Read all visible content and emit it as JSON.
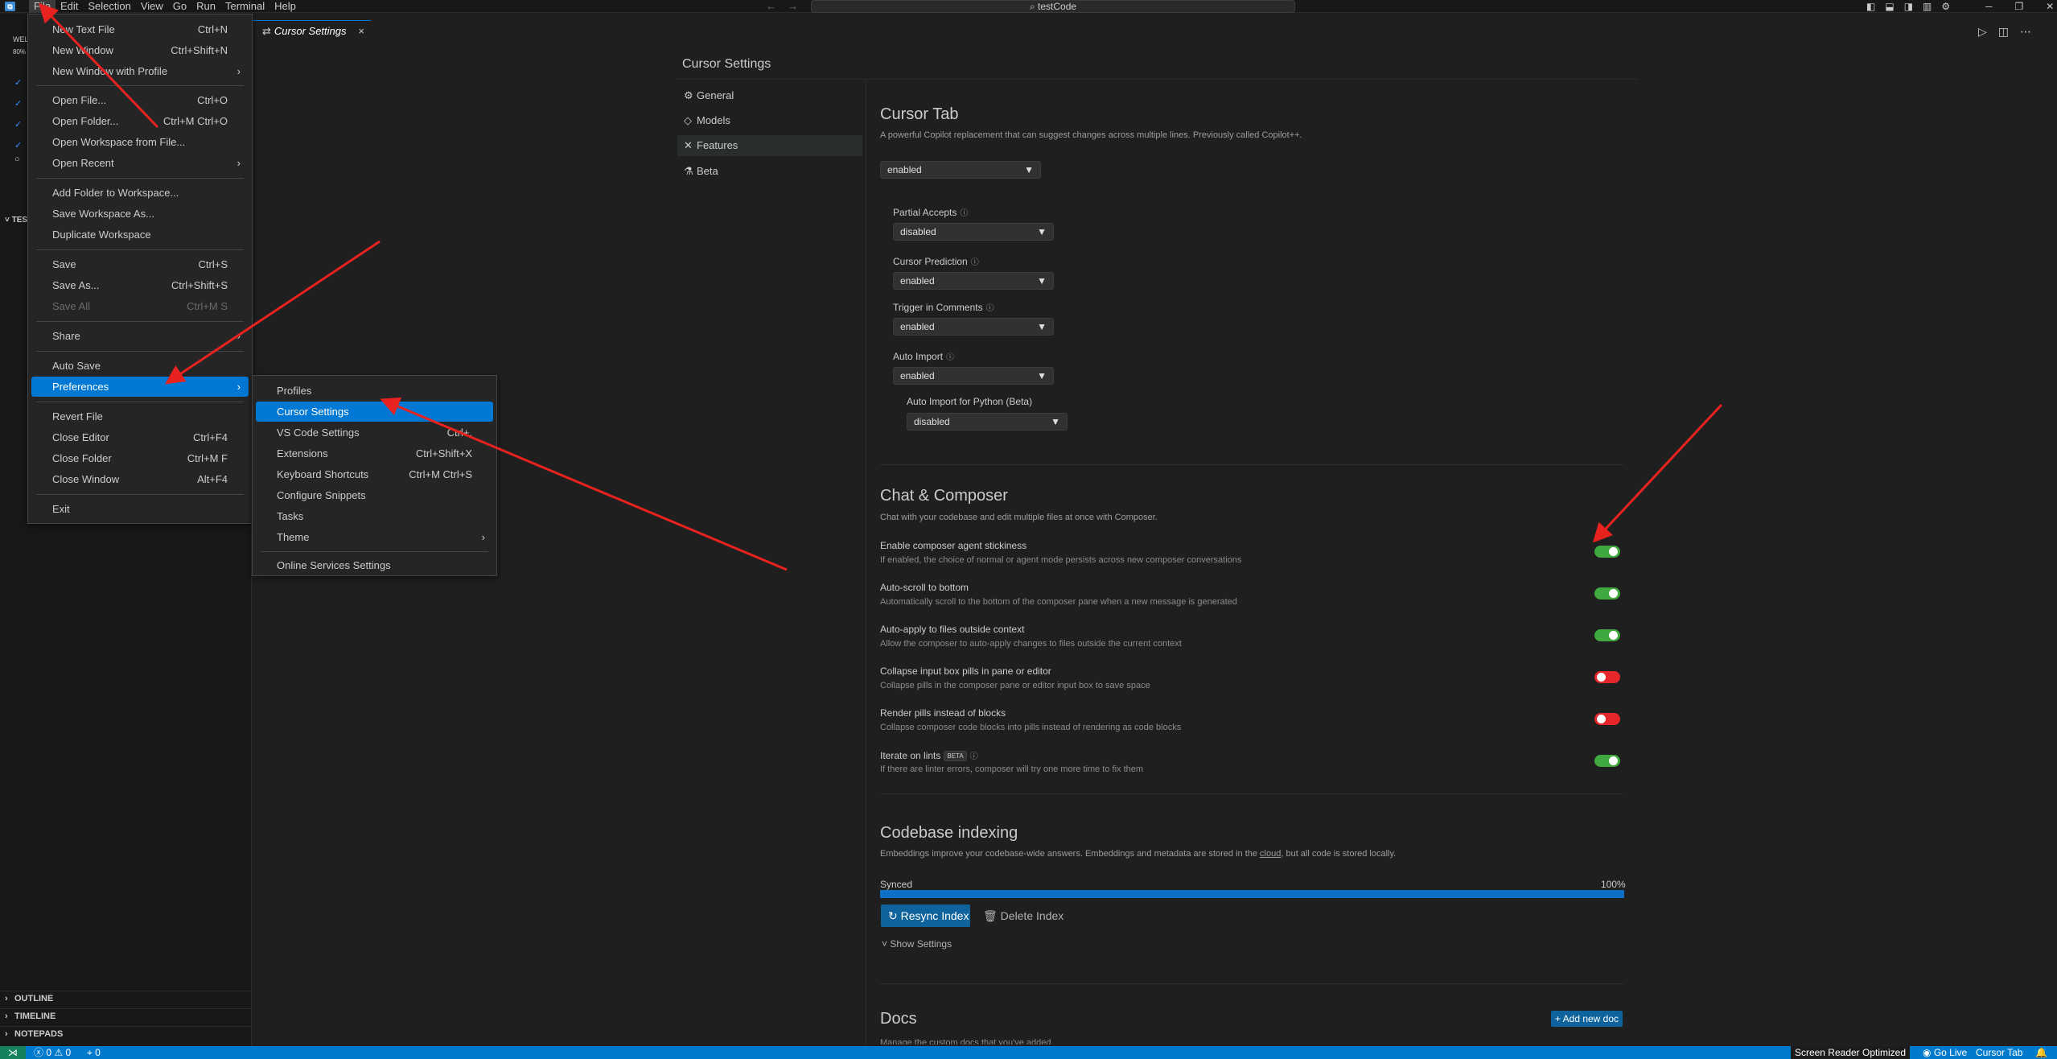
{
  "window": {
    "app_icon": "vscode-logo-icon",
    "search_text": "testCode",
    "menubar": [
      "File",
      "Edit",
      "Selection",
      "View",
      "Go",
      "Run",
      "Terminal",
      "Help"
    ]
  },
  "sidebar": {
    "peek_top": "WEL",
    "peek_pct": "80%",
    "peek_section": "TES",
    "sections": [
      "OUTLINE",
      "TIMELINE",
      "NOTEPADS"
    ]
  },
  "tabs": [
    {
      "label": "Cursor Settings",
      "close": "×"
    }
  ],
  "file_menu": [
    {
      "label": "New Text File",
      "kb": "Ctrl+N"
    },
    {
      "label": "New Window",
      "kb": "Ctrl+Shift+N"
    },
    {
      "label": "New Window with Profile",
      "kb": "",
      "sub": true
    },
    {
      "label": "Open File...",
      "kb": "Ctrl+O"
    },
    {
      "label": "Open Folder...",
      "kb": "Ctrl+M Ctrl+O"
    },
    {
      "label": "Open Workspace from File...",
      "kb": ""
    },
    {
      "label": "Open Recent",
      "kb": "",
      "sub": true
    },
    {
      "label": "Add Folder to Workspace...",
      "kb": ""
    },
    {
      "label": "Save Workspace As...",
      "kb": ""
    },
    {
      "label": "Duplicate Workspace",
      "kb": ""
    },
    {
      "label": "Save",
      "kb": "Ctrl+S"
    },
    {
      "label": "Save As...",
      "kb": "Ctrl+Shift+S"
    },
    {
      "label": "Save All",
      "kb": "Ctrl+M S",
      "disabled": true
    },
    {
      "label": "Share",
      "kb": "",
      "sub": true
    },
    {
      "label": "Auto Save",
      "kb": ""
    },
    {
      "label": "Preferences",
      "kb": "",
      "sub": true,
      "highlighted": true
    },
    {
      "label": "Revert File",
      "kb": ""
    },
    {
      "label": "Close Editor",
      "kb": "Ctrl+F4"
    },
    {
      "label": "Close Folder",
      "kb": "Ctrl+M F"
    },
    {
      "label": "Close Window",
      "kb": "Alt+F4"
    },
    {
      "label": "Exit",
      "kb": ""
    }
  ],
  "prefs_menu": [
    {
      "label": "Profiles",
      "kb": ""
    },
    {
      "label": "Cursor Settings",
      "kb": "",
      "highlighted": true
    },
    {
      "label": "VS Code Settings",
      "kb": "Ctrl+,"
    },
    {
      "label": "Extensions",
      "kb": "Ctrl+Shift+X"
    },
    {
      "label": "Keyboard Shortcuts",
      "kb": "Ctrl+M Ctrl+S"
    },
    {
      "label": "Configure Snippets",
      "kb": ""
    },
    {
      "label": "Tasks",
      "kb": ""
    },
    {
      "label": "Theme",
      "kb": "",
      "sub": true
    },
    {
      "label": "Online Services Settings",
      "kb": ""
    }
  ],
  "settings": {
    "title": "Cursor Settings",
    "nav": [
      {
        "label": "General",
        "icon": "gear-icon"
      },
      {
        "label": "Models",
        "icon": "cube-icon"
      },
      {
        "label": "Features",
        "icon": "tools-icon",
        "active": true
      },
      {
        "label": "Beta",
        "icon": "flask-icon"
      }
    ],
    "cursor_tab": {
      "title": "Cursor Tab",
      "desc": "A powerful Copilot replacement that can suggest changes across multiple lines. Previously called Copilot++.",
      "value": "enabled",
      "fields": [
        {
          "label": "Partial Accepts",
          "value": "disabled"
        },
        {
          "label": "Cursor Prediction",
          "value": "enabled"
        },
        {
          "label": "Trigger in Comments",
          "value": "enabled"
        },
        {
          "label": "Auto Import",
          "value": "enabled"
        }
      ],
      "python": {
        "label": "Auto Import for Python (Beta)",
        "value": "disabled"
      }
    },
    "chat": {
      "title": "Chat & Composer",
      "desc": "Chat with your codebase and edit multiple files at once with Composer.",
      "options": [
        {
          "title": "Enable composer agent stickiness",
          "desc": "If enabled, the choice of normal or agent mode persists across new composer conversations",
          "on": true
        },
        {
          "title": "Auto-scroll to bottom",
          "desc": "Automatically scroll to the bottom of the composer pane when a new message is generated",
          "on": true
        },
        {
          "title": "Auto-apply to files outside context",
          "desc": "Allow the composer to auto-apply changes to files outside the current context",
          "on": true
        },
        {
          "title": "Collapse input box pills in pane or editor",
          "desc": "Collapse pills in the composer pane or editor input box to save space",
          "on": false
        },
        {
          "title": "Render pills instead of blocks",
          "desc": "Collapse composer code blocks into pills instead of rendering as code blocks",
          "on": false
        },
        {
          "title": "Iterate on lints",
          "desc": "If there are linter errors, composer will try one more time to fix them",
          "on": true,
          "badge": "BETA"
        }
      ]
    },
    "indexing": {
      "title": "Codebase indexing",
      "desc_before": "Embeddings improve your codebase-wide answers. Embeddings and metadata are stored in the ",
      "desc_link": "cloud",
      "desc_after": ", but all code is stored locally.",
      "status": "Synced",
      "percent_label": "100%",
      "progress": 1.0,
      "resync": "Resync Index",
      "delete": "Delete Index",
      "show_settings": "Show Settings"
    },
    "docs": {
      "title": "Docs",
      "add": "+ Add new doc",
      "desc": "Manage the custom docs that you've added"
    }
  },
  "statusbar": {
    "errors": "0",
    "warnings": "0",
    "ports": "0",
    "screen_reader": "Screen Reader Optimized",
    "go_live": "Go Live",
    "cursor_tab": "Cursor Tab"
  },
  "colors": {
    "accent": "#0078d4",
    "toggle_on": "#3fa83f",
    "toggle_off": "#e5262b",
    "annotation": "#e8231f"
  }
}
